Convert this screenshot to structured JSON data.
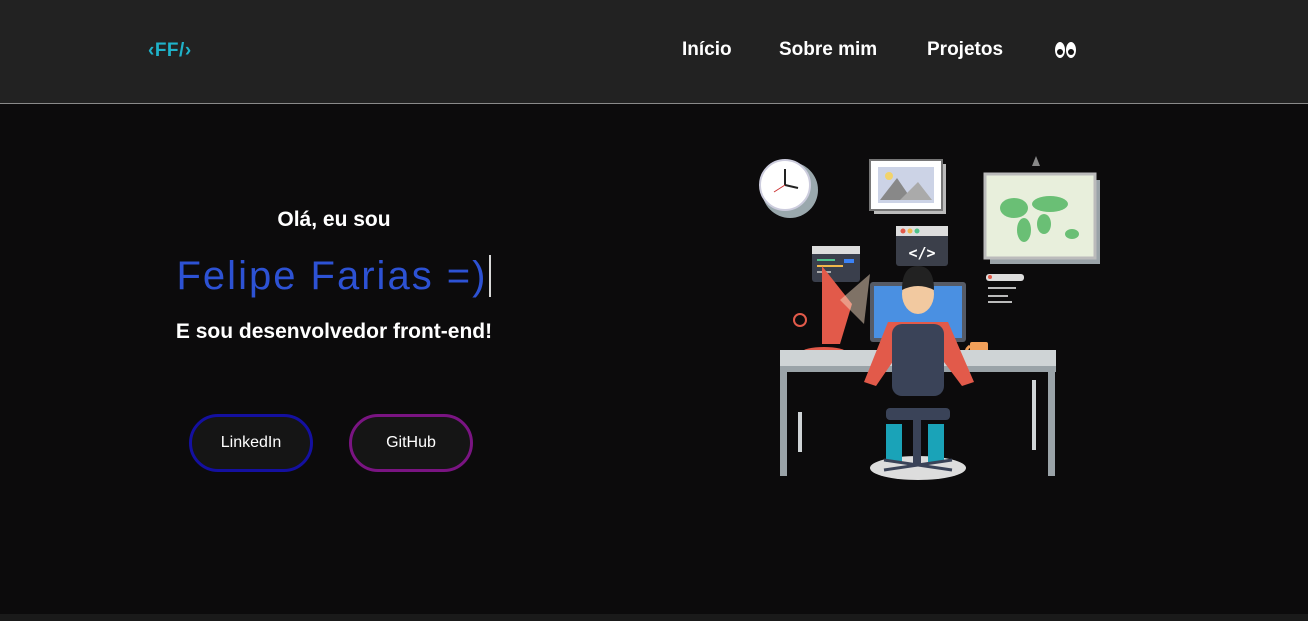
{
  "header": {
    "logo": "‹FF/›",
    "nav": {
      "home": "Início",
      "about": "Sobre mim",
      "projects": "Projetos"
    },
    "theme_toggle_icon": "eyes-icon"
  },
  "hero": {
    "greeting": "Olá, eu sou",
    "name": "Felipe Farias =)",
    "role": "E sou desenvolvedor front-end!",
    "buttons": {
      "linkedin": "LinkedIn",
      "github": "GitHub"
    },
    "illustration": "developer-at-desk-illustration"
  },
  "colors": {
    "accent_logo": "#1fb2c9",
    "name": "#2d52d4",
    "linkedin_border": "#1410a0",
    "github_border": "#7a1482",
    "header_bg": "#222222",
    "page_bg": "#0c0b0c"
  }
}
